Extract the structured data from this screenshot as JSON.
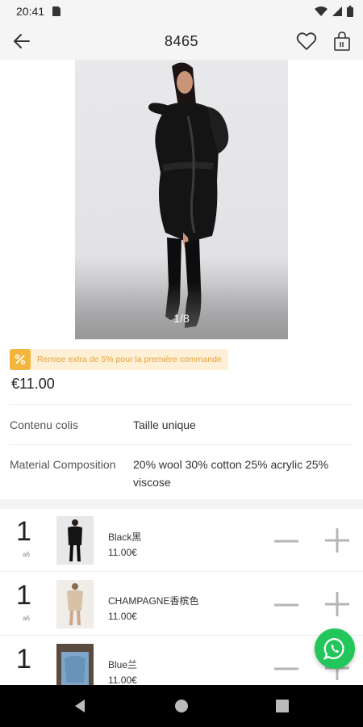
{
  "status": {
    "time": "20:41"
  },
  "header": {
    "title": "8465"
  },
  "gallery": {
    "counter": "1/8"
  },
  "promo": {
    "text": "Remise extra de 5% pour la première commande"
  },
  "product": {
    "price": "€11.00",
    "attributes": [
      {
        "label": "Contenu colis",
        "value": "Taille unique"
      },
      {
        "label": "Material Composition",
        "value": "20% wool 30% cotton 25% acrylic 25% viscose"
      }
    ]
  },
  "variants": [
    {
      "qty": "1",
      "qty_sub": "a6",
      "name": "Black黑",
      "price": "11.00€"
    },
    {
      "qty": "1",
      "qty_sub": "a6",
      "name": "CHAMPAGNE香槟色",
      "price": "11.00€"
    },
    {
      "qty": "1",
      "qty_sub": "",
      "name": "Blue兰",
      "price": "11.00€"
    }
  ],
  "colors": {
    "accent_orange": "#f3b53d",
    "promo_text": "#e6a23c",
    "whatsapp": "#22c65b"
  }
}
